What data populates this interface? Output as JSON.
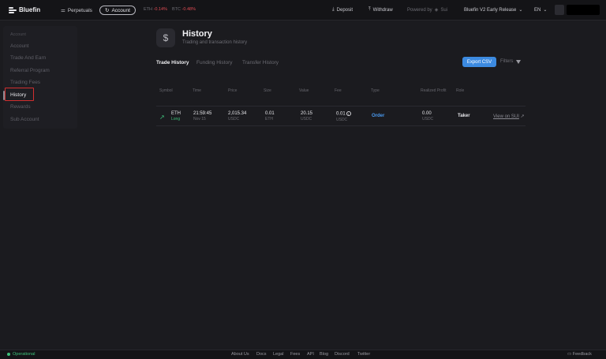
{
  "header": {
    "logo": "Bluefin",
    "perpetuals": "Perpetuals",
    "account": "Account",
    "tickers": [
      {
        "name": "ETH",
        "change": "-0.14%"
      },
      {
        "name": "BTC",
        "change": "-0.48%"
      }
    ],
    "deposit": "Deposit",
    "withdraw": "Withdraw",
    "powered_by": "Powered by",
    "powered_name": "Sui",
    "release": "Bluefin V2 Early Release",
    "language": "EN"
  },
  "sidebar": {
    "section_label": "Account",
    "items": [
      "Account",
      "Trade And Earn",
      "Referral Program",
      "Trading Fees",
      "History",
      "Rewards",
      "Sub Account"
    ],
    "active_index": 4
  },
  "page": {
    "title": "History",
    "subtitle": "Trading and transaction history",
    "tabs": [
      "Trade History",
      "Funding History",
      "Transfer History"
    ],
    "active_tab": 0,
    "export_label": "Export CSV",
    "filters_label": "Filters"
  },
  "table": {
    "headers": [
      "Symbol",
      "Time",
      "Price",
      "Size",
      "Value",
      "Fee",
      "Type",
      "Realized Profit",
      "Role"
    ],
    "rows": [
      {
        "symbol": "ETH",
        "side": "Long",
        "time": "21:59:45",
        "date": "Nov 15",
        "price": "2,015.34",
        "price_unit": "USDC",
        "size": "0.01",
        "size_unit": "ETH",
        "value": "20.15",
        "value_unit": "USDC",
        "fee": "0.01",
        "fee_unit": "USDC",
        "type": "Order",
        "profit": "0.00",
        "profit_unit": "USDC",
        "role": "Taker",
        "link": "View on SUI"
      }
    ]
  },
  "footer": {
    "status": "Operational",
    "links": [
      "About Us",
      "Docs",
      "Legal",
      "Fees",
      "API",
      "Blog",
      "Discord",
      "Twitter"
    ],
    "feedback": "Feedback"
  },
  "colors": {
    "accent": "#3c8ae0",
    "positive": "#3ec07a",
    "negative": "#e04c54",
    "highlight": "#d12f2f"
  }
}
